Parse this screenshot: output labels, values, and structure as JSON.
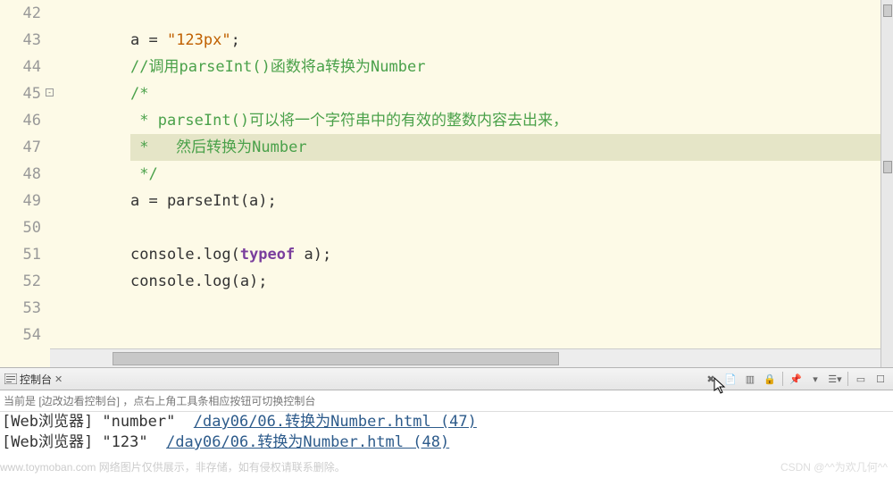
{
  "lines": [
    {
      "n": "42",
      "html": ""
    },
    {
      "n": "43",
      "html": "a = <span class='string'>\"123px\"</span>;"
    },
    {
      "n": "44",
      "html": "<span class='comment'>//调用parseInt()函数将a转换为Number</span>"
    },
    {
      "n": "45",
      "fold": true,
      "html": "<span class='comment'>/*</span>"
    },
    {
      "n": "46",
      "html": "<span class='comment'> * parseInt()可以将一个字符串中的有效的整数内容去出来，</span>"
    },
    {
      "n": "47",
      "hl": true,
      "html": "<span class='comment'> *   然后转换为Number</span>"
    },
    {
      "n": "48",
      "html": "<span class='comment'> */</span>"
    },
    {
      "n": "49",
      "html": "a = parseInt(a);"
    },
    {
      "n": "50",
      "html": ""
    },
    {
      "n": "51",
      "html": "console.log(<span class='kw'>typeof</span> a);"
    },
    {
      "n": "52",
      "html": "console.log(a);"
    },
    {
      "n": "53",
      "html": ""
    },
    {
      "n": "54",
      "html": ""
    }
  ],
  "console_tab": {
    "label": "控制台",
    "close": "✕"
  },
  "toolbar_icons": [
    "stop-icon",
    "page-icon",
    "clear-alt-icon",
    "lock-icon",
    "pin-icon",
    "down-icon",
    "new-view-icon",
    "min-icon",
    "max-icon"
  ],
  "sub_note": "当前是 [边改边看控制台] ，点右上角工具条相应按钮可切换控制台",
  "console_lines": [
    {
      "src": "[Web浏览器]",
      "val": "\"number\"",
      "link": "/day06/06.转换为Number.html (47)"
    },
    {
      "src": "[Web浏览器]",
      "val": "\"123\"",
      "link": "/day06/06.转换为Number.html (48)"
    }
  ],
  "watermarks": {
    "left": "www.toymoban.com 网络图片仅供展示，非存储，如有侵权请联系删除。",
    "right": "CSDN @^^为欢几何^^"
  }
}
